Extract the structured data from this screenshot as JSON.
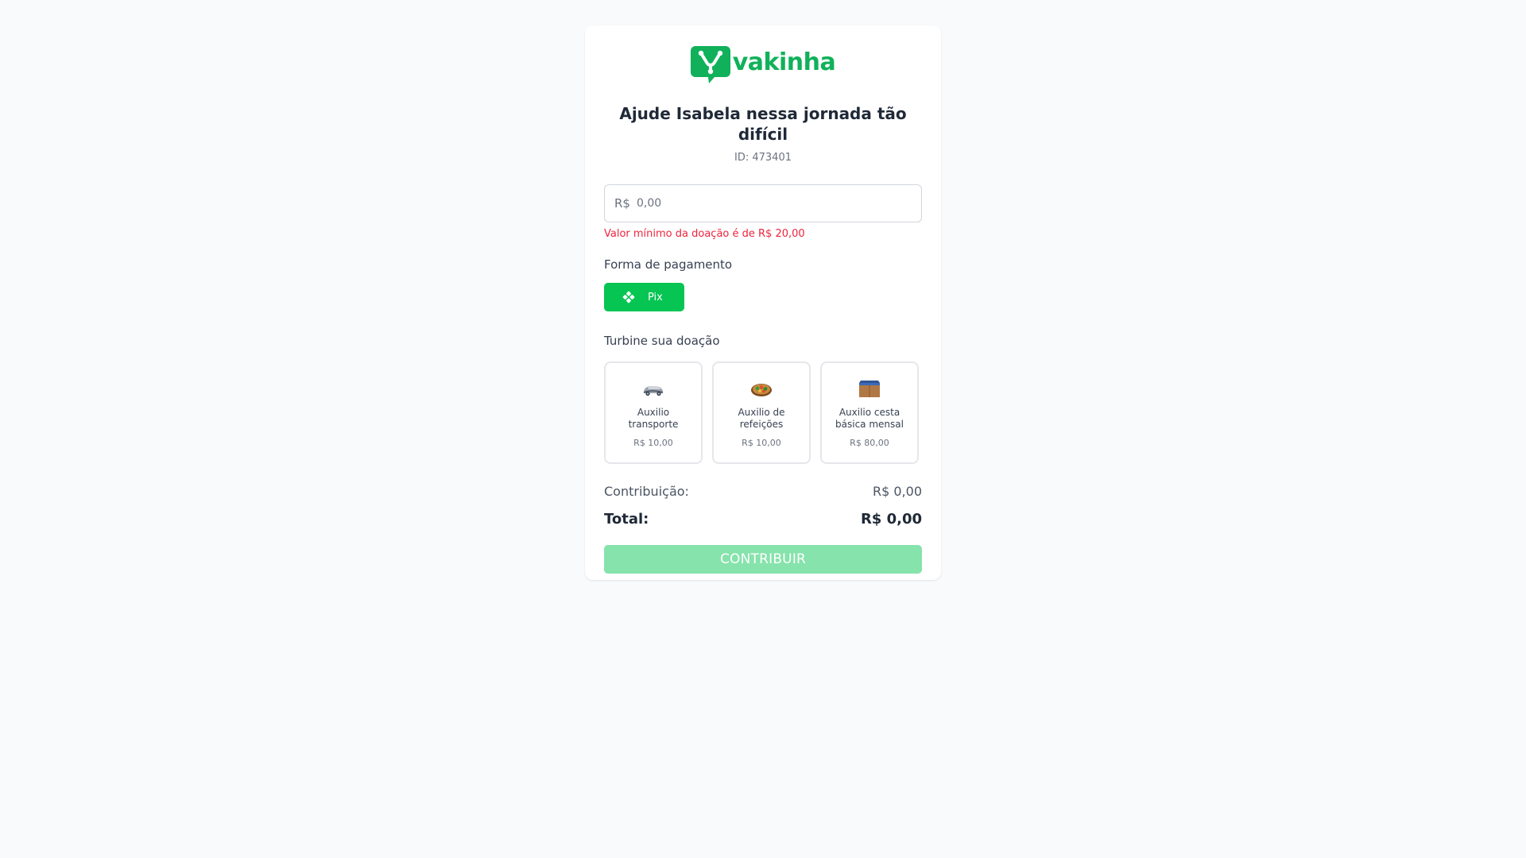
{
  "brand": {
    "name": "vakinha",
    "color": "#10b15a"
  },
  "campaign": {
    "title": "Ajude Isabela nessa jornada tão difícil",
    "id_label": "ID: 473401"
  },
  "donation": {
    "currency": "R$",
    "placeholder": "0,00",
    "error": "Valor mínimo da doação é de R$ 20,00",
    "error_color": "#ef233c"
  },
  "payment": {
    "label": "Forma de pagamento",
    "method": {
      "label": "Pix",
      "icon": "pix-icon",
      "color": "#06c553"
    }
  },
  "boost": {
    "label": "Turbine sua doação",
    "items": [
      {
        "name": "Auxilio transporte",
        "price": "R$ 10,00",
        "icon": "car-icon"
      },
      {
        "name": "Auxilio de refeições",
        "price": "R$ 10,00",
        "icon": "meal-icon"
      },
      {
        "name": "Auxilio cesta básica mensal",
        "price": "R$ 80,00",
        "icon": "box-icon"
      }
    ]
  },
  "summary": {
    "contribution_label": "Contribuição:",
    "contribution_value": "R$ 0,00",
    "total_label": "Total:",
    "total_value": "R$ 0,00"
  },
  "submit": {
    "label": "CONTRIBUIR",
    "color": "#86e3ab"
  }
}
